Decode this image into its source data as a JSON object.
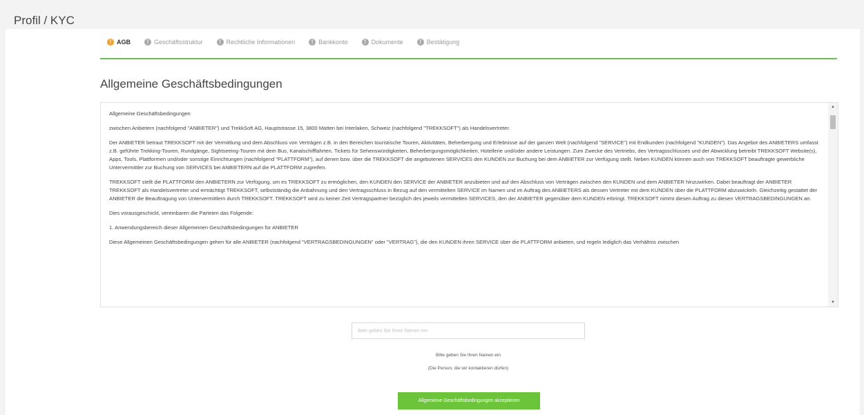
{
  "page": {
    "title": "Profil / KYC"
  },
  "steps": [
    {
      "label": "AGB",
      "icon": "info-icon",
      "active": true
    },
    {
      "label": "Geschäftsstruktur",
      "icon": "info-icon",
      "active": false
    },
    {
      "label": "Rechtliche Informationen",
      "icon": "info-icon",
      "active": false
    },
    {
      "label": "Bankkonto",
      "icon": "info-icon",
      "active": false
    },
    {
      "label": "Dokumente",
      "icon": "info-icon",
      "active": false
    },
    {
      "label": "Bestätigung",
      "icon": "info-icon",
      "active": false
    }
  ],
  "section": {
    "title": "Allgemeine Geschäftsbedingungen"
  },
  "terms": {
    "paragraphs": [
      "Allgemeine Geschäftsbedingungen",
      "zwischen Anbietern (nachfolgend \"ANBIETER\") und TrekkSoft AG, Hauptstrasse 15, 3800 Matten bei Interlaken, Schweiz (nachfolgend \"TREKKSOFT\") als Handelsvertreter.",
      "Der ANBIETER betraut TREKKSOFT mit der Vermittlung und dem Abschluss von Verträgen z.B. in den Bereichen touristische Touren, Aktivitäten, Beherbergung und Erlebnisse auf der ganzen Welt (nachfolgend \"SERVICE\") mit Endkunden (nachfolgend \"KUNDEN\"). Das Angebot des ANBIETERS umfasst z.B. geführte Trekking-Touren, Rundgänge, Sightseeing-Touren mit dem Bus, Kanalschifffahrten, Tickets für Sehenswürdigkeiten, Beherbergungsmöglichkeiten, Hotellerie und/oder andere Leistungen. Zum Zwecke des Vertriebs, des Vertragsschlusses und der Abwicklung betreibt TREKKSOFT Website(s), Apps, Tools, Plattformen und/oder sonstige Einrichtungen (nachfolgend \"PLATTFORM\"), auf denen bzw. über die TREKKSOFT die angebotenen SERVICES den KUNDEN zur Buchung bei dem ANBIETER zur Verfügung stellt. Neben KUNDEN können auch von TREKKSOFT beauftragte gewerbliche Untervermittler zur Buchung von SERVICES bei ANBIETERN auf die PLATTFORM zugreifen.",
      "TREKKSOFT stellt die PLATTFORM den ANBIETERN zur Verfügung, um es TREKKSOFT zu ermöglichen, den KUNDEN den SERVICE der ANBIETER anzubieten und auf den Abschluss von Verträgen zwischen den KUNDEN und dem ANBIETER hinzuwirken. Dabei beauftragt der ANBIETER TREKKSOFT als Handelsvertreter und ermächtigt TREKKSOFT, selbstständig die Anbahnung und den Vertragsschluss in Bezug auf den vermittelten SERVICE im Namen und im Auftrag des ANBIETERS als dessen Vertreter mit dem KUNDEN über die PLATTFORM abzuwickeln. Gleichzeitig gestattet der ANBIETER die Beauftragung von Untervermittlern durch TREKKSOFT. TREKKSOFT wird zu keiner Zeit Vertragspartner bezüglich des jeweils vermittelten SERVICES, den der ANBIETER gegenüber dem KUNDEN erbringt. TREKKSOFT nimmt diesen Auftrag zu diesen VERTRAGSBEDINGUNGEN an.",
      "Dies vorausgeschickt, vereinbaren die Parteien das Folgende:",
      "1. Anwendungsbereich dieser Allgemeinen Geschäftsbedingungen für ANBIETER",
      "Diese Allgemeinen Geschäftsbedingungen gehen für alle ANBIETER (nachfolgend \"VERTRAGSBEDINGUNGEN\" oder \"VERTRAG\"), die den KUNDEN ihren SERVICE über die PLATTFORM anbieten, und regeln lediglich das Verhältnis zwischen"
    ]
  },
  "form": {
    "name_placeholder": "Bitte geben Sie Ihren Namen ein",
    "name_value": "",
    "hint_line1": "Bitte geben Sie Ihren Namen ein",
    "hint_line2": "(Die Person, die wir kontaktieren dürfen)",
    "accept_label": "Allgemeine Geschäftsbedingungen akzeptieren"
  },
  "colors": {
    "accent_green": "#6cc43a",
    "step_active": "#f0a12a"
  }
}
